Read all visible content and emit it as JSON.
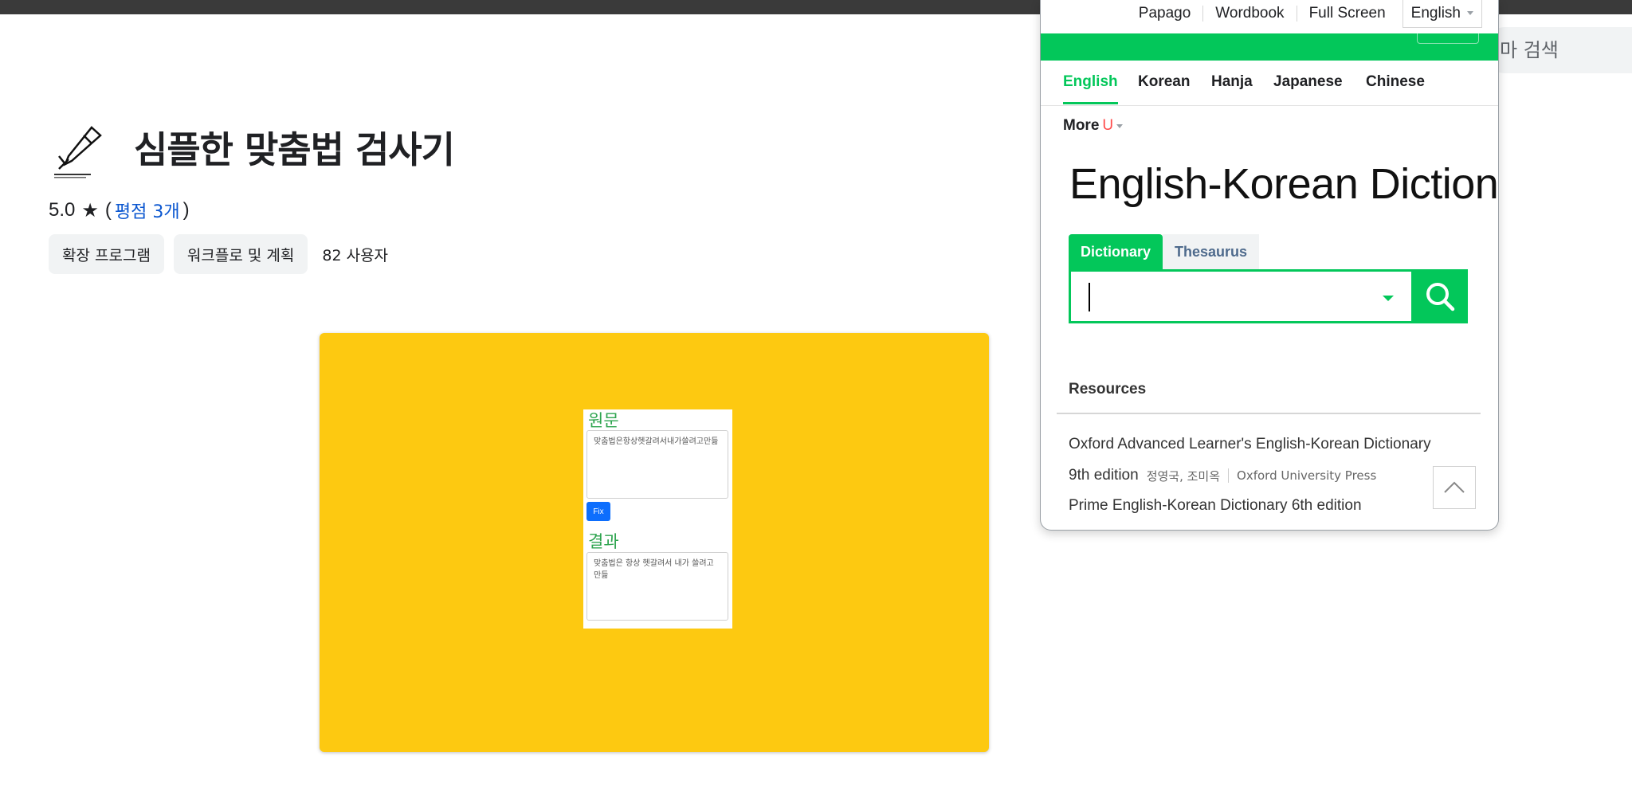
{
  "store": {
    "search_hint": "마 검색",
    "title": "심플한 맞춤법 검사기",
    "rating_value": "5.0",
    "rating_link": "평점 3개",
    "chips": [
      "확장 프로그램",
      "워크플로 및 계획"
    ],
    "users": "82 사용자"
  },
  "promo": {
    "source_label": "원문",
    "source_text": "맞춤법은항상헷갈려서내가쓸려고만듦",
    "fix_label": "Fix",
    "result_label": "결과",
    "result_text": "맞춤법은 항상 헷갈려서 내가 쓸려고 만듦",
    "bg_color": "#fdc911"
  },
  "dictionary": {
    "top_links": [
      "Papago",
      "Wordbook",
      "Full Screen"
    ],
    "language": "English",
    "tabs": [
      "English",
      "Korean",
      "Hanja",
      "Japanese",
      "Chinese"
    ],
    "active_tab": "English",
    "more_label": "More",
    "more_badge": "U",
    "heading": "English-Korean Dictionar",
    "search_tabs": [
      "Dictionary",
      "Thesaurus"
    ],
    "search_value": "",
    "resources_heading": "Resources",
    "resources": [
      {
        "title": "Oxford Advanced Learner's English-Korean Dictionary"
      },
      {
        "title": "9th edition",
        "authors": "정영국, 조미옥",
        "publisher": "Oxford University Press"
      },
      {
        "title": "Prime English-Korean Dictionary 6th edition"
      }
    ],
    "accent_color": "#03c75a"
  }
}
